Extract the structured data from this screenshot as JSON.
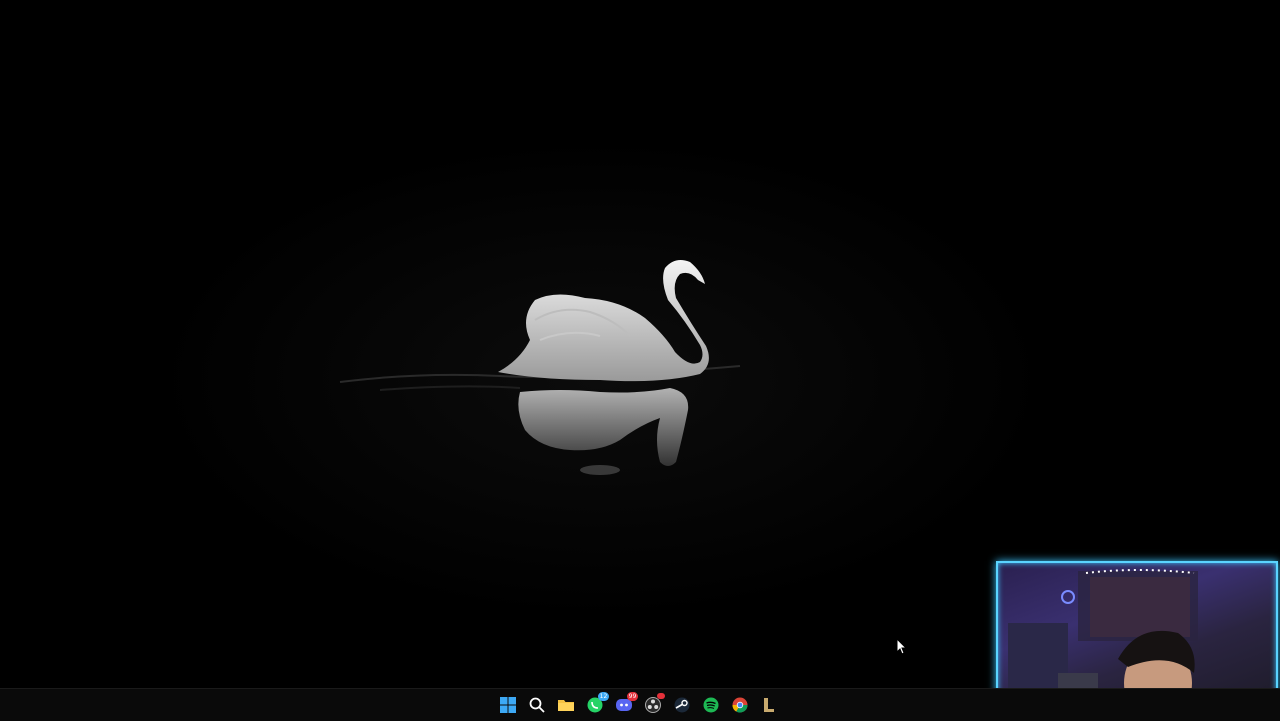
{
  "desktop": {
    "wallpaper": "swan-on-dark-water",
    "colors": {
      "background": "#000000",
      "taskbar": "#0a0a0a",
      "webcam_border": "#5ad4ff",
      "webcam_glow": "#ff3cd6"
    }
  },
  "taskbar": {
    "apps": [
      {
        "name": "start",
        "icon": "windows-start-icon"
      },
      {
        "name": "search",
        "icon": "search-icon"
      },
      {
        "name": "file-explorer",
        "icon": "folder-icon"
      },
      {
        "name": "whatsapp",
        "icon": "whatsapp-icon",
        "badge": "12"
      },
      {
        "name": "discord",
        "icon": "discord-icon",
        "badge": "99"
      },
      {
        "name": "obs",
        "icon": "obs-icon",
        "badge": ""
      },
      {
        "name": "steam",
        "icon": "steam-icon"
      },
      {
        "name": "spotify",
        "icon": "spotify-icon"
      },
      {
        "name": "chrome",
        "icon": "chrome-icon"
      },
      {
        "name": "league-of-legends",
        "icon": "league-icon"
      }
    ]
  },
  "webcam": {
    "label": "webcam-overlay"
  }
}
